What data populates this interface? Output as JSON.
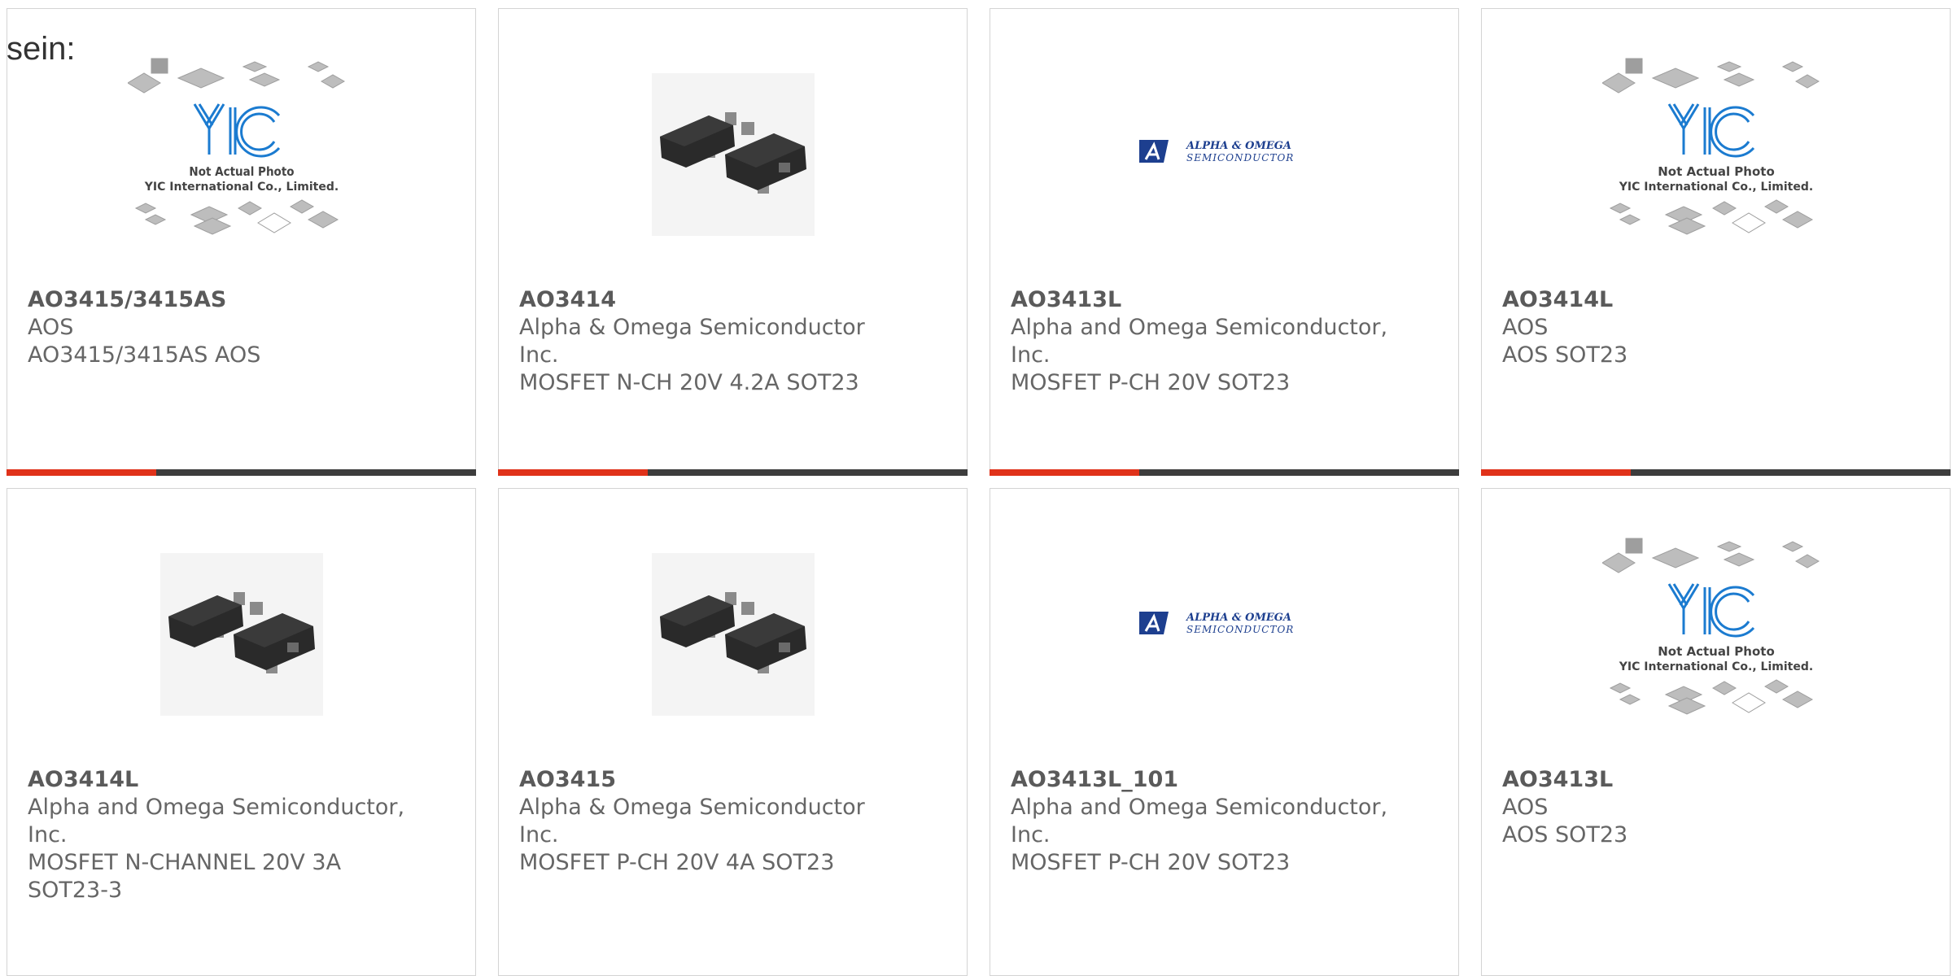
{
  "page": {
    "lead_text": "sein:"
  },
  "colors": {
    "accent": "#e0321a",
    "bar": "#3d3d3d",
    "border": "#d4d4d4",
    "yic_blue": "#1b7bd0"
  },
  "placeholder": {
    "line1": "Not Actual Photo",
    "line2": "YIC International Co., Limited.",
    "logo": "YIC"
  },
  "brand_logo": {
    "line1": "ALPHA & OMEGA",
    "line2": "SEMICONDUCTOR"
  },
  "products": [
    {
      "part": "AO3415/3415AS",
      "mfr": "AOS",
      "mfr2": "",
      "desc": "AO3415/3415AS AOS",
      "desc2": "",
      "image": "placeholder-photo"
    },
    {
      "part": "AO3414",
      "mfr": "Alpha & Omega Semiconductor",
      "mfr2": "Inc.",
      "desc": "MOSFET N-CH 20V 4.2A SOT23",
      "desc2": "",
      "image": "sot23-chip"
    },
    {
      "part": "AO3413L",
      "mfr": "Alpha and Omega Semiconductor,",
      "mfr2": "Inc.",
      "desc": "MOSFET P-CH 20V SOT23",
      "desc2": "",
      "image": "alpha-omega-logo"
    },
    {
      "part": "AO3414L",
      "mfr": "AOS",
      "mfr2": "",
      "desc": "AOS SOT23",
      "desc2": "",
      "image": "placeholder-photo"
    },
    {
      "part": "AO3414L",
      "mfr": "Alpha and Omega Semiconductor,",
      "mfr2": "Inc.",
      "desc": "MOSFET N-CHANNEL 20V 3A",
      "desc2": "SOT23-3",
      "image": "sot23-chip"
    },
    {
      "part": "AO3415",
      "mfr": "Alpha & Omega Semiconductor",
      "mfr2": "Inc.",
      "desc": "MOSFET P-CH 20V 4A SOT23",
      "desc2": "",
      "image": "sot23-chip"
    },
    {
      "part": "AO3413L_101",
      "mfr": "Alpha and Omega Semiconductor,",
      "mfr2": "Inc.",
      "desc": "MOSFET P-CH 20V SOT23",
      "desc2": "",
      "image": "alpha-omega-logo"
    },
    {
      "part": "AO3413L",
      "mfr": "AOS",
      "mfr2": "",
      "desc": "AOS SOT23",
      "desc2": "",
      "image": "placeholder-photo"
    }
  ]
}
